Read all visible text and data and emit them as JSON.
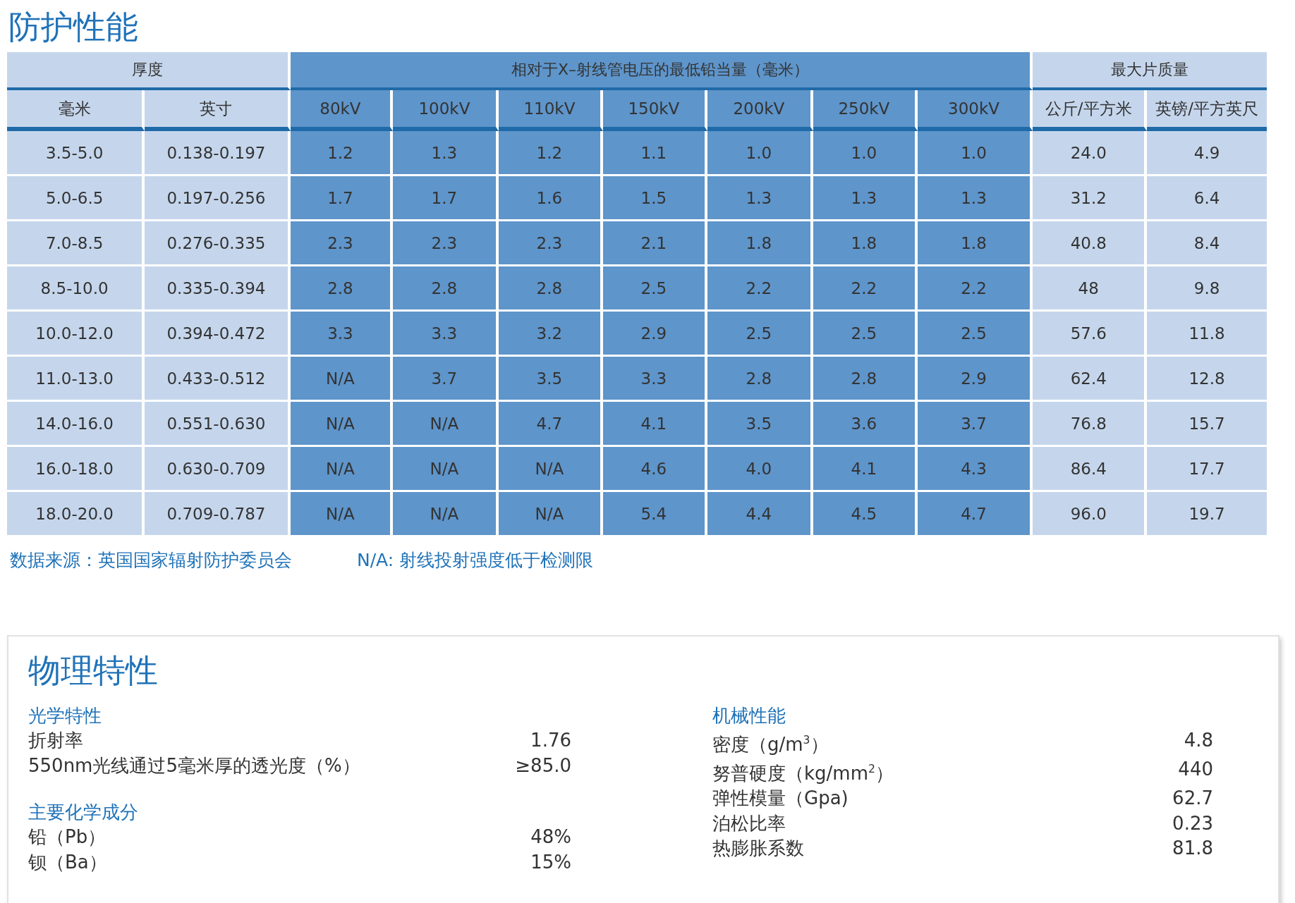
{
  "title": "防护性能",
  "table": {
    "groups": [
      {
        "label": "厚度",
        "kind": "light",
        "columns": [
          "毫米",
          "英寸"
        ]
      },
      {
        "label": "相对于X–射线管电压的最低铅当量（毫米）",
        "kind": "dark",
        "columns": [
          "80kV",
          "100kV",
          "110kV",
          "150kV",
          "200kV",
          "250kV",
          "300kV"
        ]
      },
      {
        "label": "最大片质量",
        "kind": "light",
        "columns": [
          "公斤/平方米",
          "英镑/平方英尺"
        ]
      }
    ],
    "rows": [
      [
        "3.5-5.0",
        "0.138-0.197",
        "1.2",
        "1.3",
        "1.2",
        "1.1",
        "1.0",
        "1.0",
        "1.0",
        "24.0",
        "4.9"
      ],
      [
        "5.0-6.5",
        "0.197-0.256",
        "1.7",
        "1.7",
        "1.6",
        "1.5",
        "1.3",
        "1.3",
        "1.3",
        "31.2",
        "6.4"
      ],
      [
        "7.0-8.5",
        "0.276-0.335",
        "2.3",
        "2.3",
        "2.3",
        "2.1",
        "1.8",
        "1.8",
        "1.8",
        "40.8",
        "8.4"
      ],
      [
        "8.5-10.0",
        "0.335-0.394",
        "2.8",
        "2.8",
        "2.8",
        "2.5",
        "2.2",
        "2.2",
        "2.2",
        "48",
        "9.8"
      ],
      [
        "10.0-12.0",
        "0.394-0.472",
        "3.3",
        "3.3",
        "3.2",
        "2.9",
        "2.5",
        "2.5",
        "2.5",
        "57.6",
        "11.8"
      ],
      [
        "11.0-13.0",
        "0.433-0.512",
        "N/A",
        "3.7",
        "3.5",
        "3.3",
        "2.8",
        "2.8",
        "2.9",
        "62.4",
        "12.8"
      ],
      [
        "14.0-16.0",
        "0.551-0.630",
        "N/A",
        "N/A",
        "4.7",
        "4.1",
        "3.5",
        "3.6",
        "3.7",
        "76.8",
        "15.7"
      ],
      [
        "16.0-18.0",
        "0.630-0.709",
        "N/A",
        "N/A",
        "N/A",
        "4.6",
        "4.0",
        "4.1",
        "4.3",
        "86.4",
        "17.7"
      ],
      [
        "18.0-20.0",
        "0.709-0.787",
        "N/A",
        "N/A",
        "N/A",
        "5.4",
        "4.4",
        "4.5",
        "4.7",
        "96.0",
        "19.7"
      ]
    ]
  },
  "footnotes": [
    "数据来源：英国国家辐射防护委员会",
    "N/A: 射线投射强度低于检测限"
  ],
  "physical": {
    "title": "物理特性",
    "columns": [
      [
        {
          "heading": "光学特性",
          "items": [
            {
              "label": "折射率",
              "value": "1.76"
            },
            {
              "label": "550nm光线通过5毫米厚的透光度（%）",
              "value": "≥85.0"
            }
          ]
        },
        {
          "heading": "主要化学成分",
          "items": [
            {
              "label": "铅（Pb）",
              "value": "48%"
            },
            {
              "label": "钡（Ba）",
              "value": "15%"
            }
          ]
        }
      ],
      [
        {
          "heading": "机械性能",
          "items": [
            {
              "label": "密度（g/m$^{3}$）",
              "value": "4.8"
            },
            {
              "label": "努普硬度（kg/mm$^{2}$）",
              "value": "440"
            },
            {
              "label": "弹性模量（Gpa)",
              "value": "62.7"
            },
            {
              "label": "泊松比率",
              "value": "0.23"
            },
            {
              "label": "热膨胀系数",
              "value": "81.8"
            }
          ]
        }
      ]
    ]
  }
}
